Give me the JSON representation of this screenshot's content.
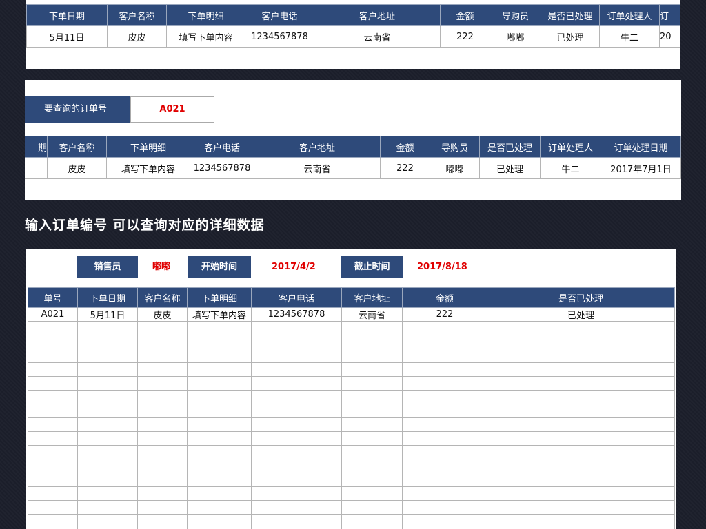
{
  "table1": {
    "headers": [
      "下单日期",
      "客户名称",
      "下单明细",
      "客户电话",
      "客户地址",
      "金额",
      "导购员",
      "是否已处理",
      "订单处理人",
      "订"
    ],
    "row": [
      "5月11日",
      "皮皮",
      "填写下单内容",
      "1234567878",
      "云南省",
      "222",
      "嘟嘟",
      "已处理",
      "牛二",
      "20"
    ]
  },
  "query": {
    "label": "要查询的订单号",
    "value": "A021"
  },
  "table2": {
    "headers": [
      "期",
      "客户名称",
      "下单明细",
      "客户电话",
      "客户地址",
      "金额",
      "导购员",
      "是否已处理",
      "订单处理人",
      "订单处理日期"
    ],
    "row": [
      "",
      "皮皮",
      "填写下单内容",
      "1234567878",
      "云南省",
      "222",
      "嘟嘟",
      "已处理",
      "牛二",
      "2017年7月1日"
    ]
  },
  "heading": "输入订单编号 可以查询对应的详细数据",
  "filter": {
    "salesperson_label": "销售员",
    "salesperson_value": "嘟嘟",
    "start_label": "开始时间",
    "start_value": "2017/4/2",
    "end_label": "截止时间",
    "end_value": "2017/8/18"
  },
  "table3": {
    "headers": [
      "单号",
      "下单日期",
      "客户名称",
      "下单明细",
      "客户电话",
      "客户地址",
      "金额",
      "是否已处理"
    ],
    "row": [
      "A021",
      "5月11日",
      "皮皮",
      "填写下单内容",
      "1234567878",
      "云南省",
      "222",
      "已处理"
    ]
  },
  "colors": {
    "header_bg": "#2e4a7a",
    "accent_red": "#e00000",
    "page_bg": "#1b1e2a"
  }
}
